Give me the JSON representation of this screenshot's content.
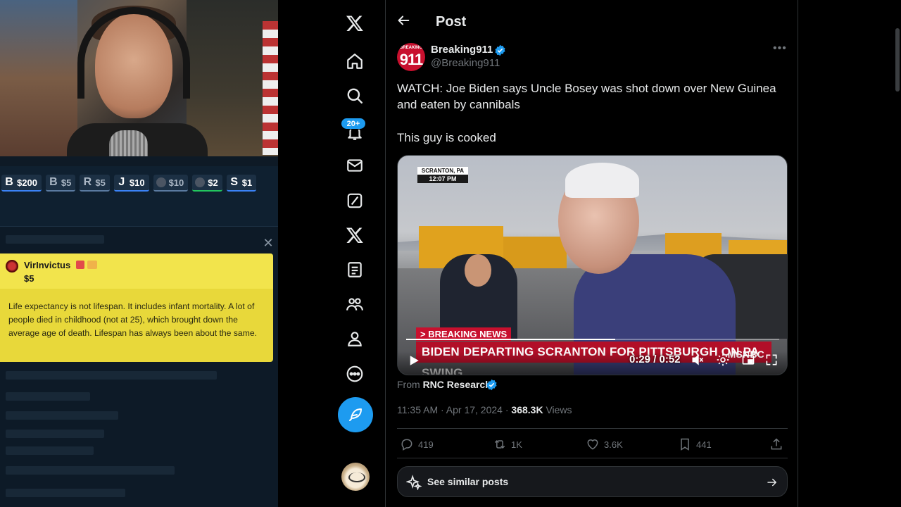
{
  "stream": {
    "badges": [
      {
        "letter": "B",
        "amount": "$200",
        "color": "#3b82f6"
      },
      {
        "letter": "B",
        "amount": "$5",
        "color": "#5a7aa0"
      },
      {
        "letter": "R",
        "amount": "$5",
        "color": "#5a7aa0"
      },
      {
        "letter": "J",
        "amount": "$10",
        "color": "#3b82f6"
      },
      {
        "letter": "",
        "amount": "$10",
        "color": "#5a7aa0"
      },
      {
        "letter": "",
        "amount": "$2",
        "color": "#22c55e"
      },
      {
        "letter": "S",
        "amount": "$1",
        "color": "#3b82f6"
      }
    ],
    "donation": {
      "username": "VirInvictus",
      "amount": "$5",
      "message": "Life expectancy is not lifespan. It includes infant mortality. A lot of people died in childhood (not at 25), which brought down the average age of death. Lifespan has always been about the same."
    }
  },
  "nav": {
    "notifications_badge": "20+",
    "items": [
      "x-logo",
      "home",
      "explore",
      "notifications",
      "messages",
      "grok",
      "premium",
      "lists",
      "communities",
      "profile",
      "more"
    ]
  },
  "header": {
    "title": "Post"
  },
  "tweet": {
    "author_name": "Breaking911",
    "author_handle": "@Breaking911",
    "avatar_small": "BREAKING",
    "avatar_big": "911",
    "text_line1": "WATCH: Joe Biden says Uncle Bosey was shot down over New Guinea and eaten by cannibals",
    "text_line2": "This guy is cooked",
    "video": {
      "location": "SCRANTON, PA",
      "time": "12:07 PM",
      "breaking": "> BREAKING NEWS",
      "lower_third": "BIDEN DEPARTING SCRANTON FOR PITTSBURGH ON PA SWING",
      "network": "MSNBC",
      "timecode": "0:29 / 0:52",
      "progress": 0.56
    },
    "from_prefix": "From",
    "from_source": "RNC Research",
    "time": "11:35 AM · Apr 17, 2024 · ",
    "views_count": "368.3K",
    "views_label": " Views",
    "replies": "419",
    "reposts": "1K",
    "likes": "3.6K",
    "bookmarks": "441"
  },
  "similar": {
    "label": "See similar posts"
  },
  "colors": {
    "accent": "#1d9bf0",
    "bg": "#000000",
    "muted": "#71767b",
    "text": "#e7e9ea",
    "donation": "#e8d83a"
  }
}
